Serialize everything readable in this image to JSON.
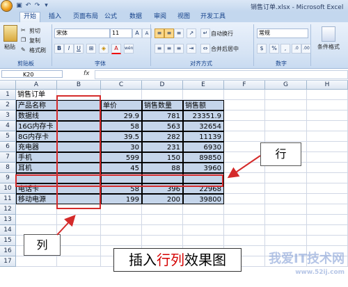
{
  "window": {
    "title": "销售订单.xlsx - Microsoft Excel"
  },
  "tabs": [
    "开始",
    "插入",
    "页面布局",
    "公式",
    "数据",
    "审阅",
    "视图",
    "开发工具"
  ],
  "ribbon": {
    "clipboard": {
      "paste": "粘贴",
      "cut": "剪切",
      "copy": "复制",
      "format_painter": "格式刷",
      "label": "剪贴板"
    },
    "font": {
      "name": "宋体",
      "size": "11",
      "bold": "B",
      "italic": "I",
      "underline": "U",
      "grow": "A",
      "shrink": "A",
      "color_a": "A",
      "phonetic": "wén",
      "label": "字体"
    },
    "alignment": {
      "wrap": "自动换行",
      "merge": "合并后居中",
      "label": "对齐方式"
    },
    "number": {
      "format": "常规",
      "percent": "%",
      "comma": ",",
      "label": "数字"
    },
    "styles": {
      "conditional": "条件格式"
    }
  },
  "formula_bar": {
    "name_box": "K20",
    "fx": "fx"
  },
  "columns": [
    "A",
    "B",
    "C",
    "D",
    "E",
    "F",
    "G",
    "H"
  ],
  "rows": [
    "1",
    "2",
    "3",
    "4",
    "5",
    "6",
    "7",
    "8",
    "9",
    "10",
    "11",
    "12",
    "13",
    "14",
    "15",
    "16",
    "17"
  ],
  "sheet": {
    "title": "销售订单",
    "headers": {
      "name": "产品名称",
      "price": "单价",
      "qty": "销售数量",
      "amount": "销售额"
    },
    "data": [
      {
        "row": 3,
        "name": "数据线",
        "price": "29.9",
        "qty": "781",
        "amount": "23351.9"
      },
      {
        "row": 4,
        "name": "16G内存卡",
        "price": "58",
        "qty": "563",
        "amount": "32654"
      },
      {
        "row": 5,
        "name": "8G内存卡",
        "price": "39.5",
        "qty": "282",
        "amount": "11139"
      },
      {
        "row": 6,
        "name": "充电器",
        "price": "30",
        "qty": "231",
        "amount": "6930"
      },
      {
        "row": 7,
        "name": "手机",
        "price": "599",
        "qty": "150",
        "amount": "89850"
      },
      {
        "row": 8,
        "name": "耳机",
        "price": "45",
        "qty": "88",
        "amount": "3960"
      },
      {
        "row": 10,
        "name": "电话卡",
        "price": "58",
        "qty": "396",
        "amount": "22968"
      },
      {
        "row": 11,
        "name": "移动电源",
        "price": "199",
        "qty": "200",
        "amount": "39800"
      }
    ]
  },
  "annotations": {
    "row_label": "行",
    "col_label": "列",
    "effect_prefix": "插入",
    "effect_highlight": "行列",
    "effect_suffix": "效果图"
  },
  "watermark": {
    "text": "我爱IT技术网",
    "domain": "www.52ij.com"
  }
}
